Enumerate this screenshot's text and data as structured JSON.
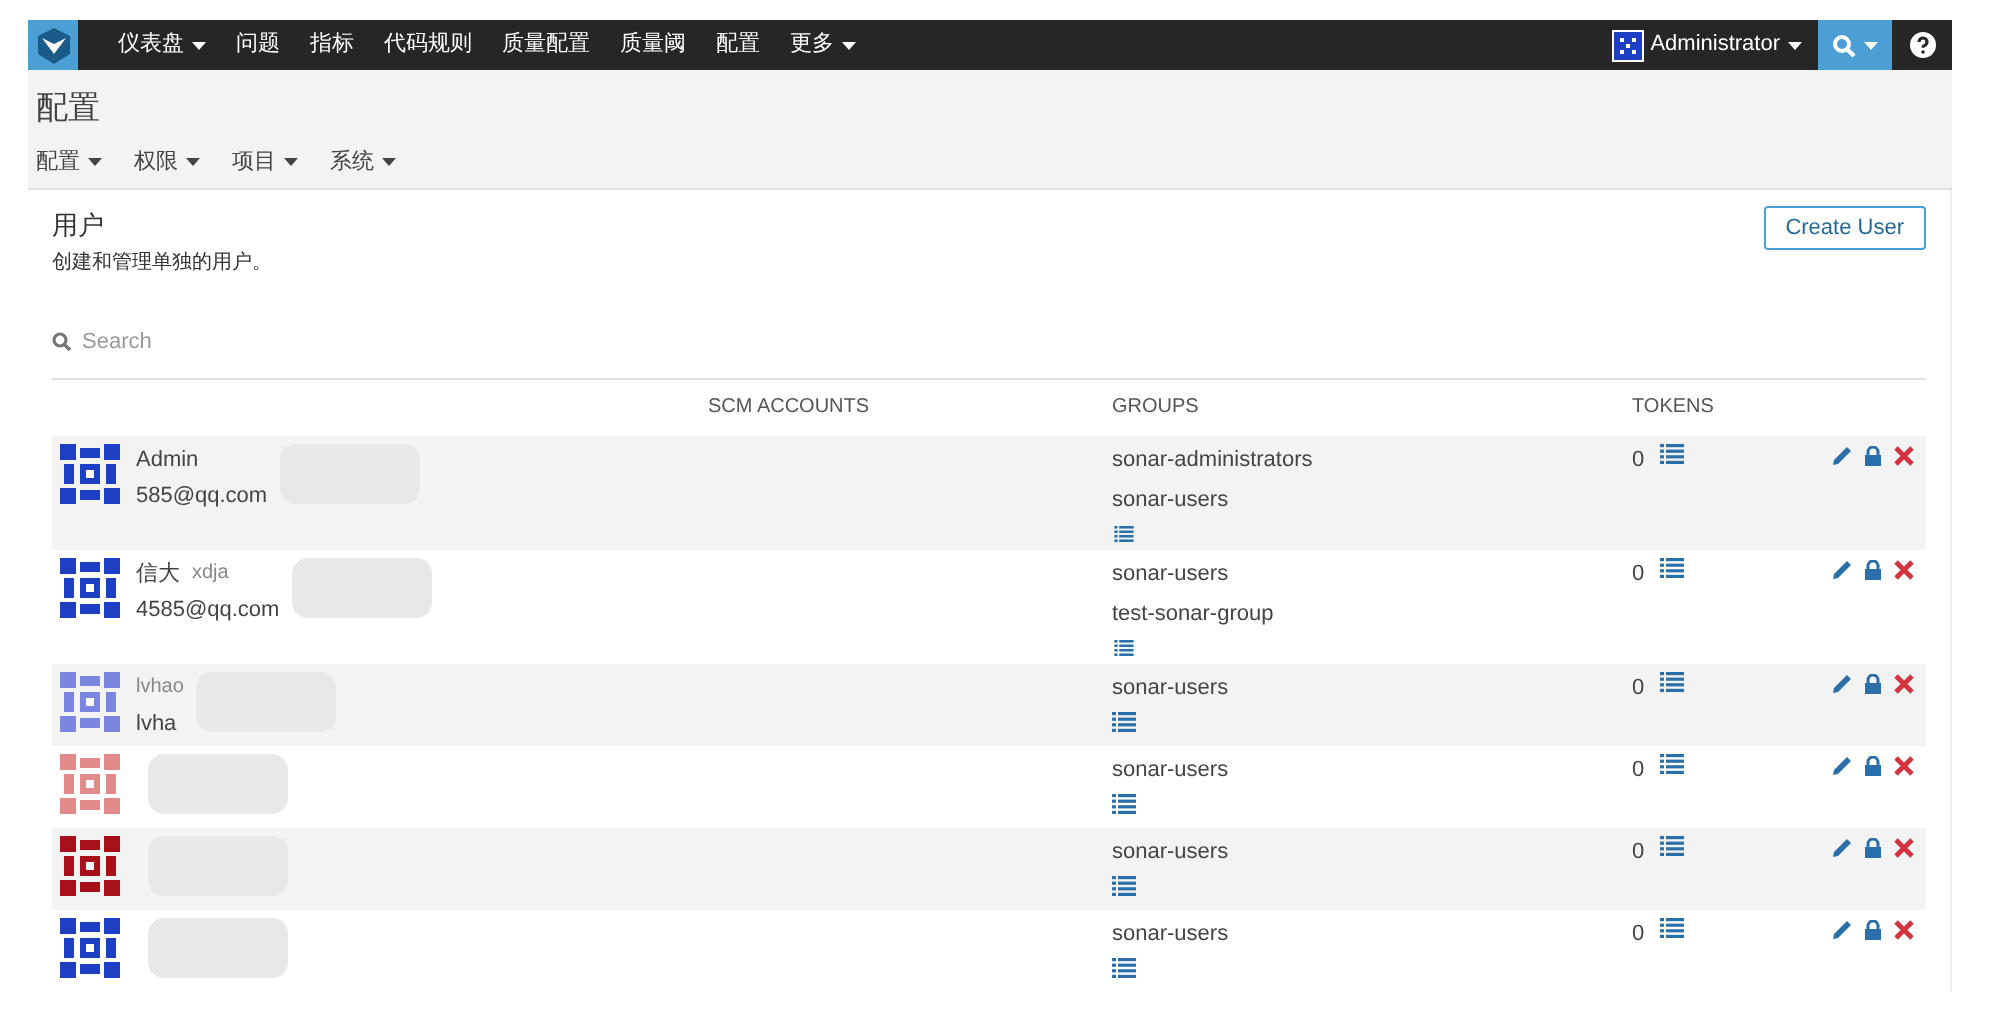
{
  "nav": {
    "items": [
      {
        "label": "仪表盘",
        "dropdown": true
      },
      {
        "label": "问题",
        "dropdown": false
      },
      {
        "label": "指标",
        "dropdown": false
      },
      {
        "label": "代码规则",
        "dropdown": false
      },
      {
        "label": "质量配置",
        "dropdown": false
      },
      {
        "label": "质量阈",
        "dropdown": false
      },
      {
        "label": "配置",
        "dropdown": false
      },
      {
        "label": "更多",
        "dropdown": true
      }
    ],
    "user": "Administrator"
  },
  "page": {
    "title": "配置",
    "menu": [
      "配置",
      "权限",
      "项目",
      "系统"
    ]
  },
  "section": {
    "title": "用户",
    "description": "创建和管理单独的用户。",
    "create_button": "Create User",
    "search_placeholder": "Search"
  },
  "table": {
    "columns": [
      "SCM ACCOUNTS",
      "GROUPS",
      "TOKENS"
    ],
    "rows": [
      {
        "name": "Admin",
        "login": "",
        "email": "585@qq.com",
        "groups": [
          "sonar-administrators",
          "sonar-users"
        ],
        "tokens": "0",
        "color": "#1d3fc4"
      },
      {
        "name": "信大",
        "login": "xdja",
        "email": "4585@qq.com",
        "groups": [
          "sonar-users",
          "test-sonar-group"
        ],
        "tokens": "0",
        "color": "#1d3fc4"
      },
      {
        "name": "",
        "login": "lvhao",
        "email": "lvha",
        "groups": [
          "sonar-users"
        ],
        "tokens": "0",
        "color": "#7b86e0"
      },
      {
        "name": "",
        "login": "",
        "email": "",
        "groups": [
          "sonar-users"
        ],
        "tokens": "0",
        "color": "#e08a8a"
      },
      {
        "name": "",
        "login": "",
        "email": "",
        "groups": [
          "sonar-users"
        ],
        "tokens": "0",
        "color": "#a8101a"
      },
      {
        "name": "",
        "login": "",
        "email": "",
        "groups": [
          "sonar-users"
        ],
        "tokens": "0",
        "color": "#1d3fc4"
      }
    ]
  }
}
